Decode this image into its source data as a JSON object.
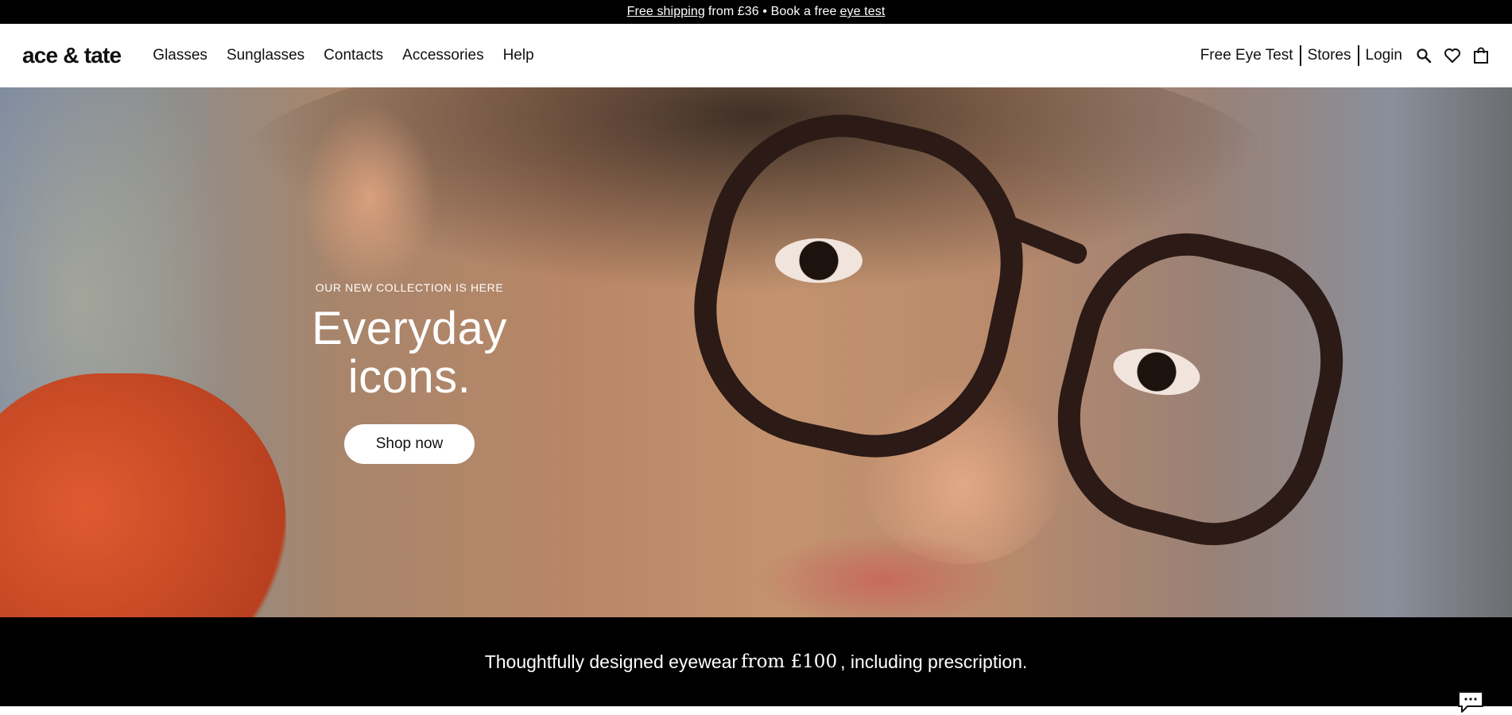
{
  "announcement": {
    "link1": "Free shipping",
    "text1": "from £36 • Book a free",
    "link2": "eye test"
  },
  "header": {
    "logo": "ace & tate",
    "nav": [
      "Glasses",
      "Sunglasses",
      "Contacts",
      "Accessories",
      "Help"
    ],
    "right_links": [
      "Free Eye Test",
      "Stores",
      "Login"
    ],
    "icons": [
      "search-icon",
      "heart-icon",
      "bag-icon"
    ]
  },
  "hero": {
    "eyebrow": "OUR NEW COLLECTION IS HERE",
    "headline": "Everyday icons.",
    "cta": "Shop now"
  },
  "tagline": {
    "part1": "Thoughtfully designed eyewear",
    "part2": "from £100",
    "part3": ", including prescription."
  },
  "chat": {
    "icon": "chat-icon"
  }
}
